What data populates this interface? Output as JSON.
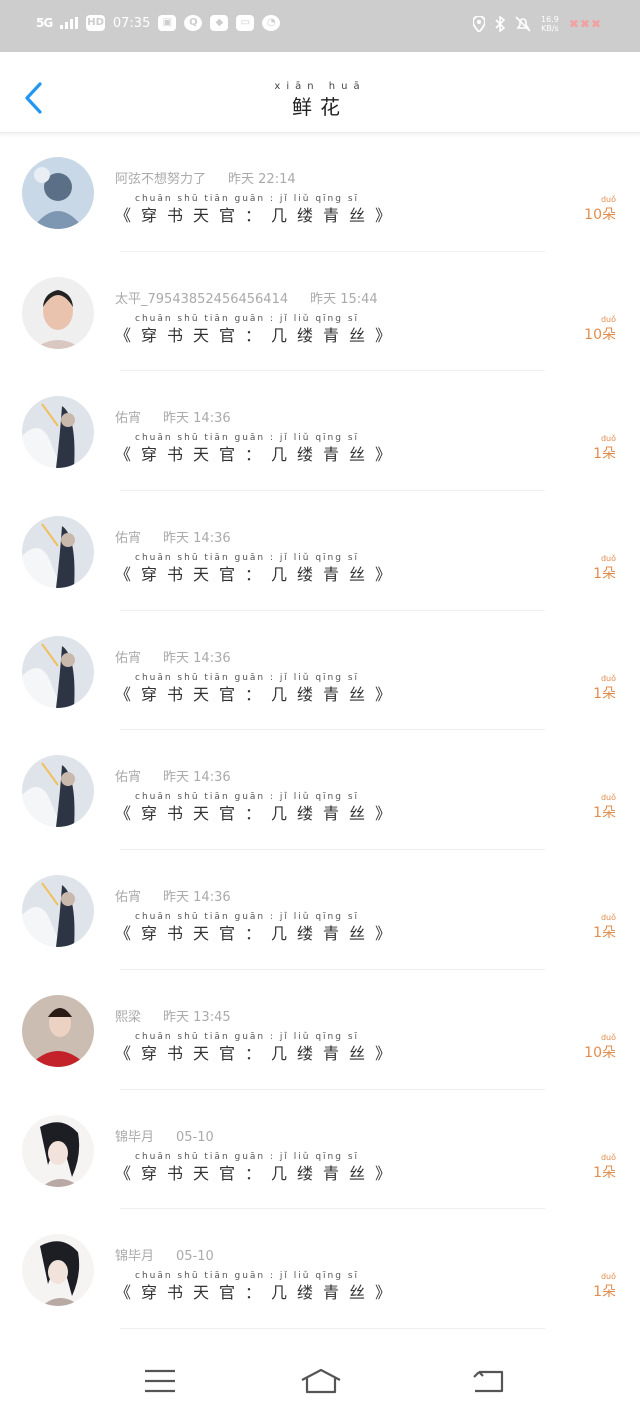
{
  "status_bar": {
    "network": "5G",
    "hd": "HD",
    "time": "07:35",
    "speed_top": "16.9",
    "speed_bottom": "KB/s"
  },
  "header": {
    "title_pinyin": "xiān huā",
    "title": "鲜花"
  },
  "book_pinyin": "chuān shū tiān guān : jǐ liǔ qīng sī",
  "flower_pinyin": "duǒ",
  "items": [
    {
      "name": "阿弦不想努力了",
      "time": "昨天 22:14",
      "book": "《穿书天官：几缕青丝》",
      "count": "10朵",
      "avatar": "blue"
    },
    {
      "name": "太平_79543852456456414",
      "time": "昨天 15:44",
      "book": "《穿书天官：几缕青丝》",
      "count": "10朵",
      "avatar": "face"
    },
    {
      "name": "佑宵",
      "time": "昨天 14:36",
      "book": "《穿书天官：几缕青丝》",
      "count": "1朵",
      "avatar": "anime"
    },
    {
      "name": "佑宵",
      "time": "昨天 14:36",
      "book": "《穿书天官：几缕青丝》",
      "count": "1朵",
      "avatar": "anime"
    },
    {
      "name": "佑宵",
      "time": "昨天 14:36",
      "book": "《穿书天官：几缕青丝》",
      "count": "1朵",
      "avatar": "anime"
    },
    {
      "name": "佑宵",
      "time": "昨天 14:36",
      "book": "《穿书天官：几缕青丝》",
      "count": "1朵",
      "avatar": "anime"
    },
    {
      "name": "佑宵",
      "time": "昨天 14:36",
      "book": "《穿书天官：几缕青丝》",
      "count": "1朵",
      "avatar": "anime"
    },
    {
      "name": "熙梁",
      "time": "昨天 13:45",
      "book": "《穿书天官：几缕青丝》",
      "count": "10朵",
      "avatar": "red"
    },
    {
      "name": "锦毕月",
      "time": "05-10",
      "book": "《穿书天官：几缕青丝》",
      "count": "1朵",
      "avatar": "sketch"
    },
    {
      "name": "锦毕月",
      "time": "05-10",
      "book": "《穿书天官：几缕青丝》",
      "count": "1朵",
      "avatar": "sketch"
    }
  ],
  "colors": {
    "status_bar": "#cdcdcd",
    "accent_blue": "#2196f3",
    "count_orange": "#e28d4e"
  }
}
